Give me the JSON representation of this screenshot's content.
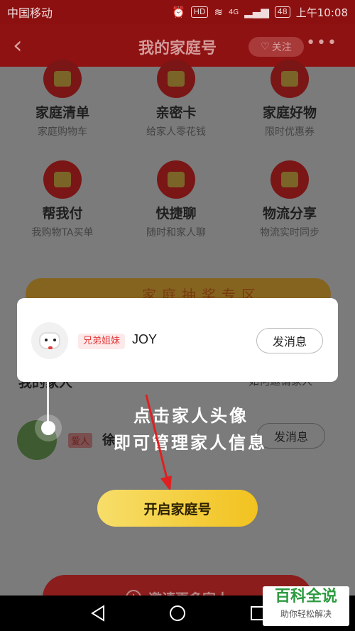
{
  "status_bar": {
    "carrier": "中国移动",
    "hd": "HD",
    "network": "4G",
    "battery": "48",
    "time": "上午10:08"
  },
  "nav": {
    "back_glyph": "‹",
    "title": "我的家庭号",
    "follow_label": "关注",
    "more_glyph": "•••"
  },
  "features": [
    {
      "name": "家庭清单",
      "sub": "家庭购物车",
      "icon": "list-icon"
    },
    {
      "name": "亲密卡",
      "sub": "给家人零花钱",
      "icon": "card-icon"
    },
    {
      "name": "家庭好物",
      "sub": "限时优惠券",
      "icon": "gift-icon"
    },
    {
      "name": "帮我付",
      "sub": "我购物TA买单",
      "icon": "pay-icon"
    },
    {
      "name": "快捷聊",
      "sub": "随时和家人聊",
      "icon": "chat-icon"
    },
    {
      "name": "物流分享",
      "sub": "物流实时同步",
      "icon": "share-icon"
    }
  ],
  "banner": {
    "text": "家庭抽奖专区"
  },
  "family_section": {
    "title": "我的家人",
    "right": "如何邀请家人"
  },
  "member": {
    "tag": "爱人",
    "name": "徐",
    "message_label": "发消息"
  },
  "invite": {
    "plus": "+",
    "label": "邀请更多家人"
  },
  "popup": {
    "tag": "兄弟姐妹",
    "name": "JOY",
    "message_label": "发消息"
  },
  "guide": {
    "line1": "点击家人头像",
    "line2": "即可管理家人信息"
  },
  "start_button": {
    "label": "开启家庭号"
  },
  "watermark": {
    "big": "百科全说",
    "small": "助你轻松解决"
  },
  "colors": {
    "accent_red": "#e43b3b",
    "button_yellow": "#f2c21f",
    "watermark_green": "#2d9a40"
  }
}
